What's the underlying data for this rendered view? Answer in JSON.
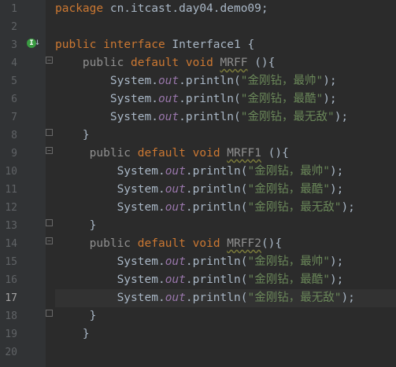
{
  "editor": {
    "line_numbers": [
      "1",
      "2",
      "3",
      "4",
      "5",
      "6",
      "7",
      "8",
      "9",
      "10",
      "11",
      "12",
      "13",
      "14",
      "15",
      "16",
      "17",
      "18",
      "19",
      "20"
    ],
    "current_line": "17",
    "package_keyword": "package",
    "package_name": " cn.itcast.day04.demo09;",
    "public_kw": "public",
    "interface_kw": "interface",
    "interface_name": " Interface1 {",
    "default_kw": "default",
    "void_kw": "void",
    "methods": [
      {
        "name": "MRFF",
        "sig_end": " (){",
        "indent": "    "
      },
      {
        "name": "MRFF1",
        "sig_end": " (){",
        "indent": "     "
      },
      {
        "name": "MRFF2",
        "sig_end": "(){",
        "indent": "     "
      }
    ],
    "system": "System.",
    "out": "out",
    "println": ".println(",
    "str1": "\"金刚钻，最帅\"",
    "str2": "\"金刚钻，最酷\"",
    "str3": "\"金刚钻，最无敌\"",
    "close_paren": ");",
    "close_brace": "}"
  }
}
